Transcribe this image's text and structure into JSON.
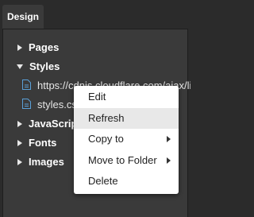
{
  "tab": {
    "label": "Design"
  },
  "tree": {
    "pages": "Pages",
    "styles": "Styles",
    "style_files": [
      "https://cdnjs.cloudflare.com/ajax/libs/bootsw",
      "styles.css"
    ],
    "javascript": "JavaScript",
    "fonts": "Fonts",
    "images": "Images"
  },
  "menu": {
    "items": [
      "Edit",
      "Refresh",
      "Copy to",
      "Move to Folder",
      "Delete"
    ]
  },
  "colors": {
    "background": "#2b2b2b",
    "panel": "#3a3a3a",
    "file_icon": "#5aa0d8",
    "menu_bg": "#ffffff",
    "menu_hover": "#e8e8e8"
  }
}
